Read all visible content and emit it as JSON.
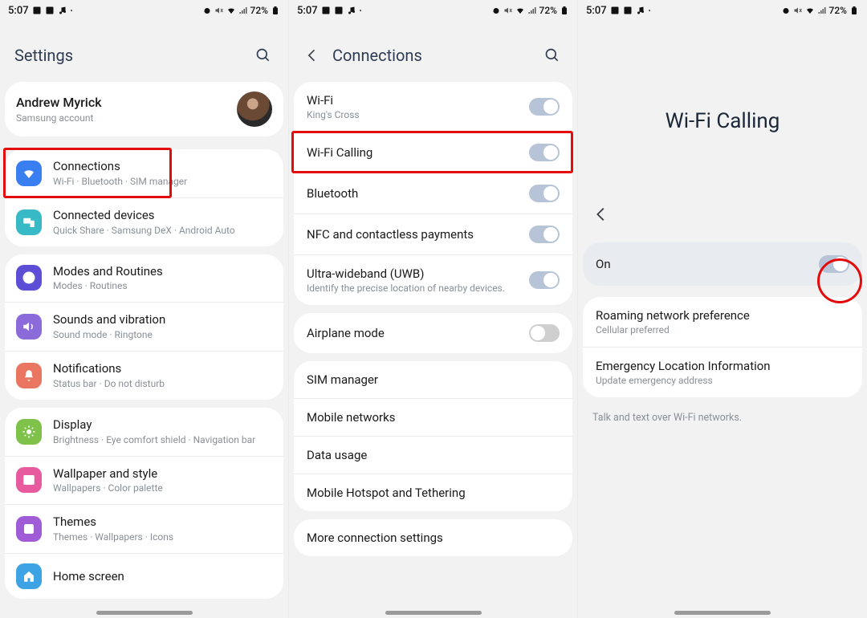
{
  "status": {
    "time": "5:07",
    "battery": "72%"
  },
  "panel1": {
    "title": "Settings",
    "account": {
      "name": "Andrew Myrick",
      "sub": "Samsung account"
    },
    "groups": [
      {
        "items": [
          {
            "id": "connections",
            "icon": "wifi",
            "color": "#3a7ff0",
            "label": "Connections",
            "sub": "Wi-Fi  ·  Bluetooth  ·  SIM manager",
            "highlight": true
          },
          {
            "id": "connected",
            "icon": "devices",
            "color": "#38b9c6",
            "label": "Connected devices",
            "sub": "Quick Share  ·  Samsung DeX  ·  Android Auto"
          }
        ]
      },
      {
        "items": [
          {
            "id": "modes",
            "icon": "check",
            "color": "#5c4fd6",
            "label": "Modes and Routines",
            "sub": "Modes  ·  Routines"
          },
          {
            "id": "sound",
            "icon": "sound",
            "color": "#8a6bd9",
            "label": "Sounds and vibration",
            "sub": "Sound mode  ·  Ringtone"
          },
          {
            "id": "notif",
            "icon": "bell",
            "color": "#ea7560",
            "label": "Notifications",
            "sub": "Status bar  ·  Do not disturb"
          }
        ]
      },
      {
        "items": [
          {
            "id": "display",
            "icon": "sun",
            "color": "#7fc24a",
            "label": "Display",
            "sub": "Brightness  ·  Eye comfort shield  ·  Navigation bar"
          },
          {
            "id": "wall",
            "icon": "image",
            "color": "#e85a9e",
            "label": "Wallpaper and style",
            "sub": "Wallpapers  ·  Color palette"
          },
          {
            "id": "themes",
            "icon": "theme",
            "color": "#a05bd6",
            "label": "Themes",
            "sub": "Themes  ·  Wallpapers  ·  Icons"
          },
          {
            "id": "home",
            "icon": "home",
            "color": "#3ea3e4",
            "label": "Home screen",
            "sub": ""
          }
        ]
      }
    ]
  },
  "panel2": {
    "title": "Connections",
    "groups": [
      {
        "items": [
          {
            "id": "wifi",
            "label": "Wi-Fi",
            "sub": "King's Cross",
            "toggle": "on"
          },
          {
            "id": "wificall",
            "label": "Wi-Fi Calling",
            "toggle": "on",
            "highlight": true
          },
          {
            "id": "bt",
            "label": "Bluetooth",
            "toggle": "on"
          },
          {
            "id": "nfc",
            "label": "NFC and contactless payments",
            "toggle": "on"
          },
          {
            "id": "uwb",
            "label": "Ultra-wideband (UWB)",
            "sub": "Identify the precise location of nearby devices.",
            "toggle": "on"
          }
        ]
      },
      {
        "items": [
          {
            "id": "air",
            "label": "Airplane mode",
            "toggle": "off"
          }
        ]
      },
      {
        "items": [
          {
            "id": "sim",
            "label": "SIM manager"
          },
          {
            "id": "mob",
            "label": "Mobile networks"
          },
          {
            "id": "data",
            "label": "Data usage"
          },
          {
            "id": "hot",
            "label": "Mobile Hotspot and Tethering"
          }
        ]
      },
      {
        "items": [
          {
            "id": "more",
            "label": "More connection settings"
          }
        ]
      }
    ]
  },
  "panel3": {
    "bigtitle": "Wi-Fi Calling",
    "on_label": "On",
    "items": [
      {
        "id": "roam",
        "label": "Roaming network preference",
        "sub": "Cellular preferred"
      },
      {
        "id": "emerg",
        "label": "Emergency Location Information",
        "sub": "Update emergency address"
      }
    ],
    "footnote": "Talk and text over Wi-Fi networks."
  }
}
